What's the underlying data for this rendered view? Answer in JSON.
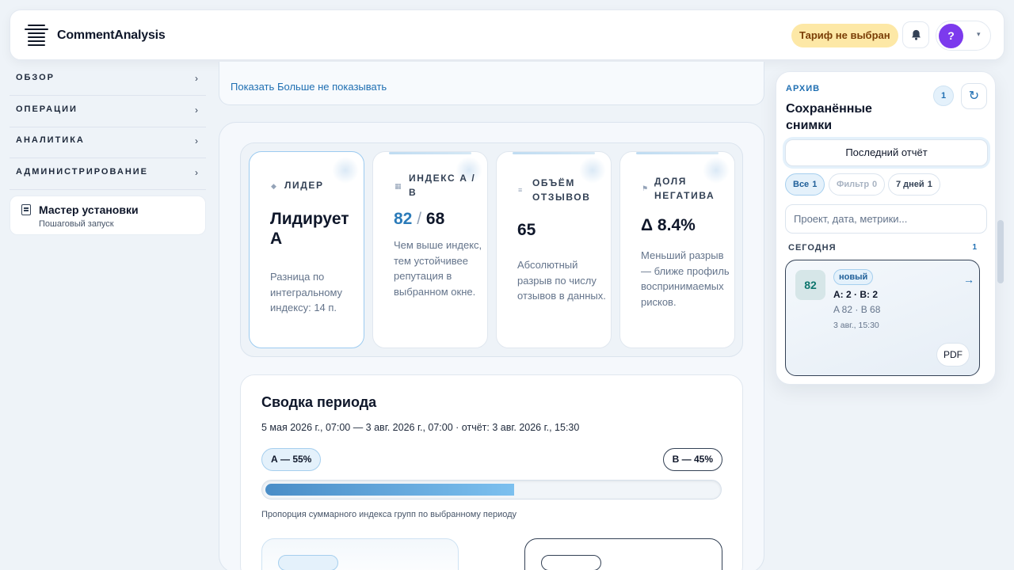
{
  "header": {
    "brand": "CommentAnalysis",
    "plan_badge": "Тариф не выбран",
    "avatar_letter": "?",
    "caret": "▾"
  },
  "sidebar": {
    "items": [
      {
        "label": "ОБЗОР",
        "arrow": "›"
      },
      {
        "label": "ОПЕРАЦИИ",
        "arrow": "›"
      },
      {
        "label": "АНАЛИТИКА",
        "arrow": "›"
      },
      {
        "label": "АДМИНИСТРИРОВАНИЕ",
        "arrow": "›"
      }
    ],
    "wizard": {
      "title": "Мастер установки",
      "subtitle": "Пошаговый запуск"
    }
  },
  "notice": {
    "show": "Показать",
    "dismiss": "Больше не показывать"
  },
  "kpis": {
    "leader": {
      "icon": "◆",
      "label": "ЛИДЕР",
      "value": "Лидирует А",
      "desc": "Разница по интегральному индексу: 14 п."
    },
    "index": {
      "icon": "▦",
      "label": "ИНДЕКС А / В",
      "value_a": "82",
      "separator": "/",
      "value_b": "68",
      "desc": "Чем выше индекс, тем устойчивее репутация в выбранном окне."
    },
    "volume": {
      "icon": "≡",
      "label": "ОБЪЁМ ОТЗЫВОВ",
      "value": "65",
      "desc": "Абсолютный разрыв по числу отзывов в данных."
    },
    "negative": {
      "icon": "⚑",
      "label": "ДОЛЯ НЕГАТИВА",
      "value": "Δ 8.4%",
      "desc": "Меньший разрыв — ближе профиль воспринимаемых рисков."
    }
  },
  "summary": {
    "title": "Сводка периода",
    "period": "5 мая 2026 г., 07:00 — 3 авг. 2026 г., 07:00 · отчёт: 3 авг. 2026 г., 15:30",
    "pill_a": "А — 55%",
    "pill_b": "В — 45%",
    "share_a": 0.55,
    "caption": "Пропорция суммарного индекса групп по выбранному периоду"
  },
  "archive": {
    "kicker": "АРХИВ",
    "title": "Сохранённые снимки",
    "count": "1",
    "refresh_icon": "↻",
    "last_report": "Последний отчёт",
    "chips": [
      {
        "label": "Все",
        "count": "1"
      },
      {
        "label": "Фильтр",
        "count": "0"
      },
      {
        "label": "7 дней",
        "count": "1"
      }
    ],
    "search_placeholder": "Проект, дата, метрики...",
    "group_label": "СЕГОДНЯ",
    "group_count": "1",
    "snapshot": {
      "score": "82",
      "badge": "новый",
      "title": "A: 2 · B: 2",
      "meta": "A 82 · B 68",
      "date": "3 авг., 15:30",
      "arrow": "→",
      "pdf": "PDF"
    }
  },
  "colors": {
    "accent": "#1f6fb2",
    "plan_badge_bg": "#fde8a6",
    "avatar_bg": "#7c3aed",
    "leader_border": "#9ccbf0"
  }
}
